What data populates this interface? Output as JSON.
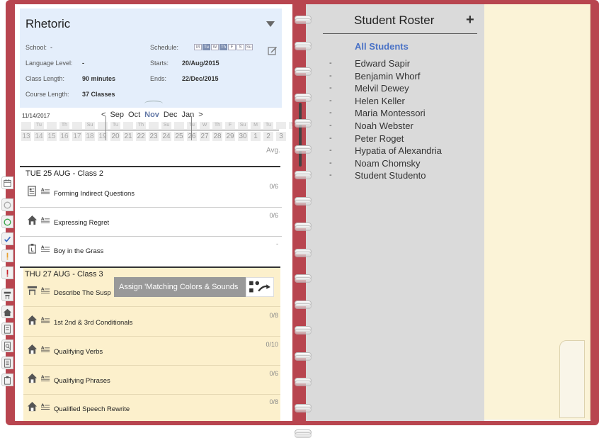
{
  "course": {
    "title": "Rhetoric",
    "school_label": "School:",
    "school_value": "-",
    "schedule_label": "Schedule:",
    "days": [
      {
        "label": "M",
        "on": false
      },
      {
        "label": "Tu",
        "on": true
      },
      {
        "label": "W",
        "on": false
      },
      {
        "label": "Th",
        "on": true
      },
      {
        "label": "F",
        "on": false
      },
      {
        "label": "S",
        "on": false
      },
      {
        "label": "Su",
        "on": false
      }
    ],
    "language_label": "Language Level:",
    "language_value": "-",
    "starts_label": "Starts:",
    "starts_value": "20/Aug/2015",
    "length_label": "Class Length:",
    "length_value": "90 minutes",
    "ends_label": "Ends:",
    "ends_value": "22/Dec/2015",
    "course_length_label": "Course Length:",
    "course_length_value": "37 Classes"
  },
  "calendar": {
    "date": "11/14/2017",
    "prev": "<",
    "next": ">",
    "months": [
      "Sep",
      "Oct",
      "Nov",
      "Dec",
      "Jan"
    ],
    "current_month": "Nov",
    "weekdays": [
      "",
      "Tu",
      "",
      "Th",
      "",
      "Su",
      "",
      "Tu",
      "",
      "Th",
      "",
      "Su",
      "",
      "Tu",
      "W",
      "Th",
      "F",
      "Su",
      "M",
      "Tu",
      "",
      "Th",
      "F",
      "Sa",
      ""
    ],
    "numbers": [
      "13",
      "14",
      "15",
      "16",
      "17",
      "18",
      "19",
      "20",
      "21",
      "22",
      "23",
      "24",
      "25",
      "26",
      "27",
      "28",
      "29",
      "30",
      "1",
      "2",
      "3"
    ],
    "avg": "Avg."
  },
  "classes": [
    {
      "header": "TUE 25 AUG - Class 2",
      "lessons": [
        {
          "label": "Forming Indirect Questions",
          "score": "0/6",
          "icon": "document-icon"
        },
        {
          "label": "Expressing Regret",
          "score": "0/6",
          "icon": "home-icon"
        },
        {
          "label": "Boy in the Grass",
          "score": "-",
          "icon": "clipboard-icon"
        }
      ]
    },
    {
      "header": "THU 27 AUG - Class 3",
      "lessons": [
        {
          "label": "Describe The Susp",
          "score": "",
          "icon": "classroom-icon"
        },
        {
          "label": "1st 2nd & 3rd Conditionals",
          "score": "0/8",
          "icon": "home-icon"
        },
        {
          "label": "Qualifying Verbs",
          "score": "0/10",
          "icon": "home-icon"
        },
        {
          "label": "Qualifying Phrases",
          "score": "0/6",
          "icon": "home-icon"
        },
        {
          "label": "Qualified Speech Rewrite",
          "score": "0/8",
          "icon": "home-icon"
        }
      ]
    }
  ],
  "tooltip": {
    "text": "Assign 'Matching Colors & Sounds"
  },
  "roster": {
    "title": "Student Roster",
    "add": "+",
    "all": "All Students",
    "dash": "-",
    "students": [
      "Edward Sapir",
      "Benjamin Whorf",
      "Melvil Dewey",
      "Helen Keller",
      "Maria Montessori",
      "Noah Webster",
      "Peter Roget",
      "Hypatia of Alexandria",
      "Noam Chomsky",
      "Student Studento"
    ]
  },
  "colors": {
    "cover": "#b8454f",
    "accent": "#4a72c6",
    "header_bg": "#e4eefb",
    "class_bg": "#fcf0cc"
  }
}
